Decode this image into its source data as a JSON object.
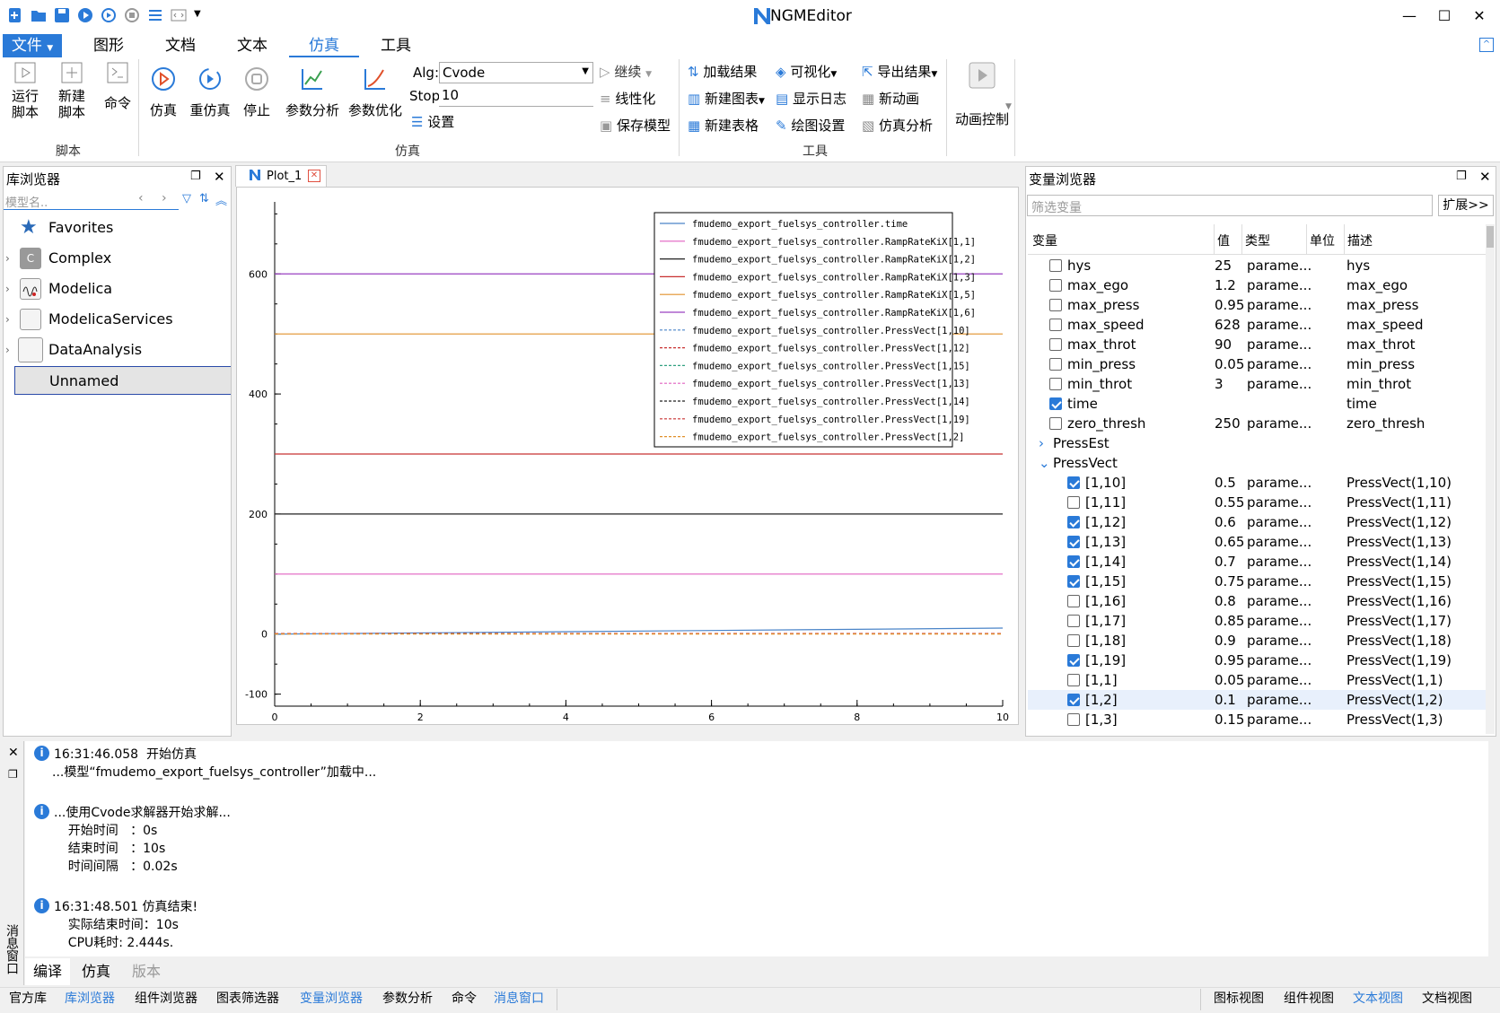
{
  "app": {
    "title": "NGMEditor"
  },
  "menu": {
    "tabs": [
      "文件",
      "图形",
      "文档",
      "文本",
      "仿真",
      "工具"
    ]
  },
  "ribbon": {
    "script_group": {
      "label": "脚本",
      "run_script": [
        "运行",
        "脚本"
      ],
      "new_script": [
        "新建",
        "脚本"
      ],
      "command": "命令"
    },
    "sim_group": {
      "label": "仿真",
      "simulate": "仿真",
      "resimulate": "重仿真",
      "stop": "停止",
      "param_analysis": "参数分析",
      "param_opt": "参数优化",
      "alg_label": "Alg:",
      "alg_value": "Cvode",
      "stop_label": "Stop:",
      "stop_value": "10",
      "settings": "设置",
      "continue": "继续",
      "linearize": "线性化",
      "save_model": "保存模型"
    },
    "tools_group": {
      "label": "工具",
      "load_results": "加载结果",
      "visualize": "可视化",
      "export_results": "导出结果",
      "new_chart": "新建图表",
      "show_log": "显示日志",
      "new_animation": "新动画",
      "new_table": "新建表格",
      "plot_settings": "绘图设置",
      "sim_analysis": "仿真分析"
    },
    "animation": {
      "label": "动画控制"
    }
  },
  "library": {
    "title": "库浏览器",
    "search_placeholder": "模型名..",
    "items": [
      "Favorites",
      "Complex",
      "Modelica",
      "ModelicaServices",
      "DataAnalysis",
      "Unnamed"
    ]
  },
  "plot": {
    "tab": "Plot_1"
  },
  "chart_data": {
    "type": "line",
    "xlim": [
      0,
      10
    ],
    "ylim": [
      -120,
      720
    ],
    "xticks": [
      "0",
      "2",
      "4",
      "6",
      "8",
      "10"
    ],
    "yticks": [
      "-100",
      "0",
      "200",
      "400",
      "600"
    ],
    "legend_position": "top-right",
    "series": [
      {
        "name": "fmudemo_export_fuelsys_controller.time",
        "color": "#4a84c8",
        "dash": false,
        "x": [
          0,
          10
        ],
        "y": [
          0,
          10
        ]
      },
      {
        "name": "fmudemo_export_fuelsys_controller.RampRateKiX[1,1]",
        "color": "#e060c0",
        "dash": false,
        "x": [
          0,
          10
        ],
        "y": [
          100,
          100
        ]
      },
      {
        "name": "fmudemo_export_fuelsys_controller.RampRateKiX[1,2]",
        "color": "#202020",
        "dash": false,
        "x": [
          0,
          10
        ],
        "y": [
          200,
          200
        ]
      },
      {
        "name": "fmudemo_export_fuelsys_controller.RampRateKiX[1,3]",
        "color": "#c83030",
        "dash": false,
        "x": [
          0,
          10
        ],
        "y": [
          300,
          300
        ]
      },
      {
        "name": "fmudemo_export_fuelsys_controller.RampRateKiX[1,5]",
        "color": "#e0902a",
        "dash": false,
        "x": [
          0,
          10
        ],
        "y": [
          500,
          500
        ]
      },
      {
        "name": "fmudemo_export_fuelsys_controller.RampRateKiX[1,6]",
        "color": "#9a40c0",
        "dash": false,
        "x": [
          0,
          10
        ],
        "y": [
          600,
          600
        ]
      },
      {
        "name": "fmudemo_export_fuelsys_controller.PressVect[1,10]",
        "color": "#4a84c8",
        "dash": true,
        "x": [
          0,
          10
        ],
        "y": [
          0.5,
          0.5
        ]
      },
      {
        "name": "fmudemo_export_fuelsys_controller.PressVect[1,12]",
        "color": "#c83030",
        "dash": true,
        "x": [
          0,
          10
        ],
        "y": [
          0.6,
          0.6
        ]
      },
      {
        "name": "fmudemo_export_fuelsys_controller.PressVect[1,15]",
        "color": "#30a080",
        "dash": true,
        "x": [
          0,
          10
        ],
        "y": [
          0.75,
          0.75
        ]
      },
      {
        "name": "fmudemo_export_fuelsys_controller.PressVect[1,13]",
        "color": "#e060c0",
        "dash": true,
        "x": [
          0,
          10
        ],
        "y": [
          0.65,
          0.65
        ]
      },
      {
        "name": "fmudemo_export_fuelsys_controller.PressVect[1,14]",
        "color": "#202020",
        "dash": true,
        "x": [
          0,
          10
        ],
        "y": [
          0.7,
          0.7
        ]
      },
      {
        "name": "fmudemo_export_fuelsys_controller.PressVect[1,19]",
        "color": "#c83030",
        "dash": true,
        "x": [
          0,
          10
        ],
        "y": [
          0.95,
          0.95
        ]
      },
      {
        "name": "fmudemo_export_fuelsys_controller.PressVect[1,2]",
        "color": "#e0902a",
        "dash": true,
        "x": [
          0,
          10
        ],
        "y": [
          0.1,
          0.1
        ]
      }
    ]
  },
  "variables": {
    "title": "变量浏览器",
    "filter_placeholder": "筛选变量",
    "expand_button": "扩展>>",
    "columns": [
      "变量",
      "值",
      "类型",
      "单位",
      "描述"
    ],
    "rows": [
      {
        "name": "hys",
        "value": "25",
        "type": "parame...",
        "desc": "hys",
        "checked": false,
        "level": 1
      },
      {
        "name": "max_ego",
        "value": "1.2",
        "type": "parame...",
        "desc": "max_ego",
        "checked": false,
        "level": 1
      },
      {
        "name": "max_press",
        "value": "0.95",
        "type": "parame...",
        "desc": "max_press",
        "checked": false,
        "level": 1
      },
      {
        "name": "max_speed",
        "value": "628",
        "type": "parame...",
        "desc": "max_speed",
        "checked": false,
        "level": 1
      },
      {
        "name": "max_throt",
        "value": "90",
        "type": "parame...",
        "desc": "max_throt",
        "checked": false,
        "level": 1
      },
      {
        "name": "min_press",
        "value": "0.05",
        "type": "parame...",
        "desc": "min_press",
        "checked": false,
        "level": 1
      },
      {
        "name": "min_throt",
        "value": "3",
        "type": "parame...",
        "desc": "min_throt",
        "checked": false,
        "level": 1
      },
      {
        "name": "time",
        "value": "",
        "type": "",
        "desc": "time",
        "checked": true,
        "level": 1
      },
      {
        "name": "zero_thresh",
        "value": "250",
        "type": "parame...",
        "desc": "zero_thresh",
        "checked": false,
        "level": 1
      },
      {
        "name": "PressEst",
        "value": "",
        "type": "",
        "desc": "",
        "group": "collapsed",
        "level": 0
      },
      {
        "name": "PressVect",
        "value": "",
        "type": "",
        "desc": "",
        "group": "expanded",
        "level": 0
      },
      {
        "name": "[1,10]",
        "value": "0.5",
        "type": "parame...",
        "desc": "PressVect(1,10)",
        "checked": true,
        "level": 2
      },
      {
        "name": "[1,11]",
        "value": "0.55",
        "type": "parame...",
        "desc": "PressVect(1,11)",
        "checked": false,
        "level": 2
      },
      {
        "name": "[1,12]",
        "value": "0.6",
        "type": "parame...",
        "desc": "PressVect(1,12)",
        "checked": true,
        "level": 2
      },
      {
        "name": "[1,13]",
        "value": "0.65",
        "type": "parame...",
        "desc": "PressVect(1,13)",
        "checked": true,
        "level": 2
      },
      {
        "name": "[1,14]",
        "value": "0.7",
        "type": "parame...",
        "desc": "PressVect(1,14)",
        "checked": true,
        "level": 2
      },
      {
        "name": "[1,15]",
        "value": "0.75",
        "type": "parame...",
        "desc": "PressVect(1,15)",
        "checked": true,
        "level": 2
      },
      {
        "name": "[1,16]",
        "value": "0.8",
        "type": "parame...",
        "desc": "PressVect(1,16)",
        "checked": false,
        "level": 2
      },
      {
        "name": "[1,17]",
        "value": "0.85",
        "type": "parame...",
        "desc": "PressVect(1,17)",
        "checked": false,
        "level": 2
      },
      {
        "name": "[1,18]",
        "value": "0.9",
        "type": "parame...",
        "desc": "PressVect(1,18)",
        "checked": false,
        "level": 2
      },
      {
        "name": "[1,19]",
        "value": "0.95",
        "type": "parame...",
        "desc": "PressVect(1,19)",
        "checked": true,
        "level": 2
      },
      {
        "name": "[1,1]",
        "value": "0.05",
        "type": "parame...",
        "desc": "PressVect(1,1)",
        "checked": false,
        "level": 2
      },
      {
        "name": "[1,2]",
        "value": "0.1",
        "type": "parame...",
        "desc": "PressVect(1,2)",
        "checked": true,
        "level": 2,
        "selected": true
      },
      {
        "name": "[1,3]",
        "value": "0.15",
        "type": "parame...",
        "desc": "PressVect(1,3)",
        "checked": false,
        "level": 2
      }
    ]
  },
  "messages": {
    "panel_title": "消息窗口",
    "lines": [
      {
        "info": true,
        "text": "16:31:46.058  开始仿真"
      },
      {
        "info": false,
        "text": "...模型“fmudemo_export_fuelsys_controller”加载中..."
      },
      {
        "info": false,
        "text": ""
      },
      {
        "info": true,
        "text": "...使用Cvode求解器开始求解..."
      },
      {
        "info": false,
        "text": "    开始时间   ：0s"
      },
      {
        "info": false,
        "text": "    结束时间   ：10s"
      },
      {
        "info": false,
        "text": "    时间间隔   ：0.02s"
      },
      {
        "info": false,
        "text": ""
      },
      {
        "info": true,
        "text": "16:31:48.501 仿真结束!"
      },
      {
        "info": false,
        "text": "    实际结束时间：10s"
      },
      {
        "info": false,
        "text": "    CPU耗时: 2.444s."
      }
    ],
    "tabs": [
      "编译",
      "仿真",
      "版本"
    ]
  },
  "bottom_left_tabs": [
    "官方库",
    "库浏览器",
    "组件浏览器",
    "图表筛选器",
    "变量浏览器",
    "参数分析",
    "命令",
    "消息窗口"
  ],
  "bottom_right_tabs": [
    "图标视图",
    "组件视图",
    "文本视图",
    "文档视图"
  ]
}
